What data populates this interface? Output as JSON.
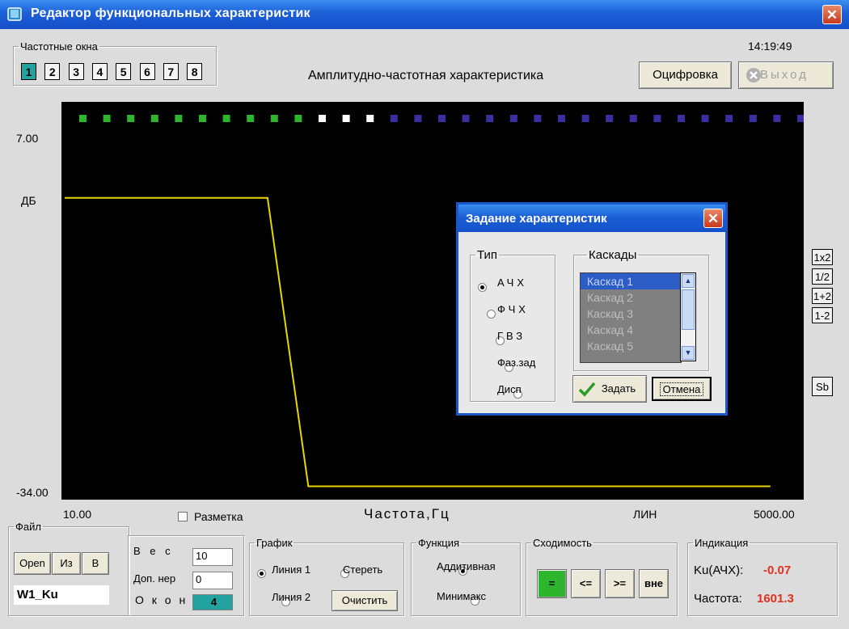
{
  "window": {
    "title": "Редактор функциональных характеристик",
    "close_glyph": "✕",
    "icon": "app-book-icon",
    "time": "14:19:49"
  },
  "freq_windows": {
    "legend": "Частотные окна",
    "buttons": [
      "1",
      "2",
      "3",
      "4",
      "5",
      "6",
      "7",
      "8"
    ],
    "active_index": 0
  },
  "header": {
    "chart_title": "Амплитудно-частотная характеристика",
    "digitize_label": "Оцифровка",
    "exit_label": "Выход"
  },
  "plot": {
    "ytop_label": "7.00",
    "yunit_label": "ДБ",
    "ybottom_label": "-34.00",
    "xleft_label": "10.00",
    "xright_label": "5000.00",
    "xlabel": "Частота,Гц",
    "scale_label": "ЛИН",
    "grid_label": "Разметка",
    "grid_checked": false,
    "indicator_colors": {
      "green": "#2db52d",
      "white": "#ffffff",
      "blue": "#3a2ea0"
    },
    "indicators": [
      "g",
      "g",
      "g",
      "g",
      "g",
      "g",
      "g",
      "g",
      "g",
      "g",
      "w",
      "w",
      "w",
      "b",
      "b",
      "b",
      "b",
      "b",
      "b",
      "b",
      "b",
      "b",
      "b",
      "b",
      "b",
      "b",
      "b",
      "b",
      "b",
      "b",
      "b"
    ],
    "line_color": "#e8d600"
  },
  "chart_data": {
    "type": "line",
    "title": "Амплитудно-частотная характеристика",
    "xlabel": "Частота,Гц",
    "ylabel": "ДБ",
    "xlim": [
      10,
      5000
    ],
    "ylim": [
      -34,
      7
    ],
    "xscale": "linear",
    "series": [
      {
        "x": [
          10,
          1426,
          1711,
          4937
        ],
        "y": [
          0,
          0,
          -32.5,
          -32.5
        ]
      }
    ]
  },
  "side_buttons": [
    "1x2",
    "1/2",
    "1+2",
    "1-2"
  ],
  "sb_label": "Sb",
  "file_panel": {
    "legend": "Файл",
    "open_label": "Open",
    "iz_label": "Из",
    "v_label": "В",
    "filename": "W1_Ku"
  },
  "weights_panel": {
    "ves_label": "В е с",
    "ves_value": "10",
    "dopner_label": "Доп. нер",
    "dopner_value": "0",
    "okon_label": "О к о н",
    "okon_value": "4"
  },
  "graph_panel": {
    "legend": "График",
    "line1_label": "Линия 1",
    "line2_label": "Линия 2",
    "erase_label": "Стереть",
    "clear_label": "Очистить"
  },
  "function_panel": {
    "legend": "Функция",
    "additive_label": "Аддитивная",
    "minimax_label": "Минимакс"
  },
  "convergence_panel": {
    "legend": "Сходимость",
    "eq_label": "=",
    "le_label": "<=",
    "ge_label": ">=",
    "out_label": "вне",
    "eq_color": "#2db52d"
  },
  "indication_panel": {
    "legend": "Индикация",
    "ku_label": "Ku(АЧХ):",
    "ku_value": "-0.07",
    "freq_label": "Частота:",
    "freq_value": "1601.3"
  },
  "dialog": {
    "title": "Задание характеристик",
    "type_legend": "Тип",
    "types": [
      "АЧХ",
      "ФЧХ",
      "ГВЗ",
      "Фаз.зад",
      "Дисп"
    ],
    "selected_type": 0,
    "cascades_legend": "Каскады",
    "cascades": [
      "Каскад 1",
      "Каскад 2",
      "Каскад 3",
      "Каскад 4",
      "Каскад 5"
    ],
    "selected_cascade": 0,
    "ok_label": "Задать",
    "cancel_label": "Отмена"
  }
}
